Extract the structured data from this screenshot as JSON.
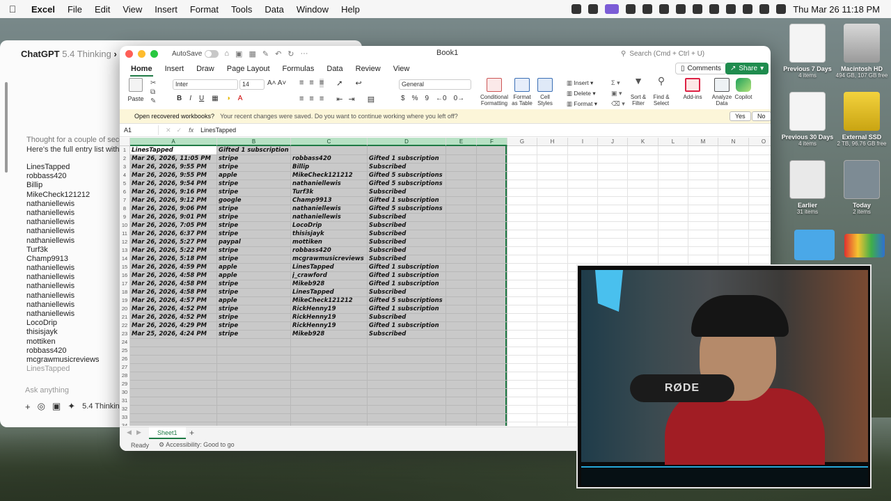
{
  "menubar": {
    "app": "Excel",
    "items": [
      "File",
      "Edit",
      "View",
      "Insert",
      "Format",
      "Tools",
      "Data",
      "Window",
      "Help"
    ],
    "datetime": "Thu Mar 26  11:18 PM"
  },
  "chat": {
    "title": "ChatGPT",
    "model": "5.4 Thinking",
    "thought": "Thought for a couple of seconds",
    "intro": "Here's the full entry list with names",
    "names": [
      "LinesTapped",
      "robbass420",
      "Billip",
      "MikeCheck121212",
      "nathaniellewis",
      "nathaniellewis",
      "nathaniellewis",
      "nathaniellewis",
      "nathaniellewis",
      "Turf3k",
      "Champ9913",
      "nathaniellewis",
      "nathaniellewis",
      "nathaniellewis",
      "nathaniellewis",
      "nathaniellewis",
      "nathaniellewis",
      "LocoDrip",
      "thisisjayk",
      "mottiken",
      "robbass420",
      "mcgrawmusicreviews",
      "LinesTapped"
    ],
    "ask_placeholder": "Ask anything",
    "model_short": "5.4 Thinkin"
  },
  "excel": {
    "autosave": "AutoSave",
    "doc_title": "Book1",
    "search_placeholder": "Search (Cmd + Ctrl + U)",
    "tabs": [
      "Home",
      "Insert",
      "Draw",
      "Page Layout",
      "Formulas",
      "Data",
      "Review",
      "View"
    ],
    "comments": "Comments",
    "share": "Share",
    "ribbon": {
      "paste": "Paste",
      "font": "Inter",
      "size": "14",
      "number_format": "General",
      "conditional": "Conditional Formatting",
      "format_table": "Format as Table",
      "cell_styles": "Cell Styles",
      "insert": "Insert",
      "delete": "Delete",
      "format": "Format",
      "sort_filter": "Sort & Filter",
      "find_select": "Find & Select",
      "addins": "Add-ins",
      "analyze": "Analyze Data",
      "copilot": "Copilot"
    },
    "notice": {
      "title": "Open recovered workbooks?",
      "message": "Your recent changes were saved. Do you want to continue working where you left off?",
      "yes": "Yes",
      "no": "No"
    },
    "namebox": "A1",
    "formula": "LinesTapped",
    "columns": [
      "A",
      "B",
      "C",
      "D",
      "E",
      "F",
      "G",
      "H",
      "I",
      "J",
      "K",
      "L",
      "M",
      "N",
      "O"
    ],
    "rows": [
      [
        "LinesTapped",
        "Gifted 1 subscription",
        "",
        ""
      ],
      [
        "Mar 26, 2026, 11:05 PM",
        "stripe",
        "robbass420",
        "Gifted 1 subscription"
      ],
      [
        "Mar 26, 2026, 9:55 PM",
        "stripe",
        "Billip",
        "Subscribed"
      ],
      [
        "Mar 26, 2026, 9:55 PM",
        "apple",
        "MikeCheck121212",
        "Gifted 5 subscriptions"
      ],
      [
        "Mar 26, 2026, 9:54 PM",
        "stripe",
        "nathaniellewis",
        "Gifted 5 subscriptions"
      ],
      [
        "Mar 26, 2026, 9:16 PM",
        "stripe",
        "Turf3k",
        "Subscribed"
      ],
      [
        "Mar 26, 2026, 9:12 PM",
        "google",
        "Champ9913",
        "Gifted 1 subscription"
      ],
      [
        "Mar 26, 2026, 9:06 PM",
        "stripe",
        "nathaniellewis",
        "Gifted 5 subscriptions"
      ],
      [
        "Mar 26, 2026, 9:01 PM",
        "stripe",
        "nathaniellewis",
        "Subscribed"
      ],
      [
        "Mar 26, 2026, 7:05 PM",
        "stripe",
        "LocoDrip",
        "Subscribed"
      ],
      [
        "Mar 26, 2026, 6:37 PM",
        "stripe",
        "thisisjayk",
        "Subscribed"
      ],
      [
        "Mar 26, 2026, 5:27 PM",
        "paypal",
        "mottiken",
        "Subscribed"
      ],
      [
        "Mar 26, 2026, 5:22 PM",
        "stripe",
        "robbass420",
        "Subscribed"
      ],
      [
        "Mar 26, 2026, 5:18 PM",
        "stripe",
        "mcgrawmusicreviews",
        "Subscribed"
      ],
      [
        "Mar 26, 2026, 4:59 PM",
        "apple",
        "LinesTapped",
        "Gifted 1 subscription"
      ],
      [
        "Mar 26, 2026, 4:58 PM",
        "apple",
        "j_crawford",
        "Gifted 1 subscription"
      ],
      [
        "Mar 26, 2026, 4:58 PM",
        "stripe",
        "Mikeb928",
        "Gifted 1 subscription"
      ],
      [
        "Mar 26, 2026, 4:58 PM",
        "stripe",
        "LinesTapped",
        "Subscribed"
      ],
      [
        "Mar 26, 2026, 4:57 PM",
        "apple",
        "MikeCheck121212",
        "Gifted 5 subscriptions"
      ],
      [
        "Mar 26, 2026, 4:52 PM",
        "stripe",
        "RickHenny19",
        "Gifted 1 subscription"
      ],
      [
        "Mar 26, 2026, 4:52 PM",
        "stripe",
        "RickHenny19",
        "Subscribed"
      ],
      [
        "Mar 26, 2026, 4:29 PM",
        "stripe",
        "RickHenny19",
        "Gifted 1 subscription"
      ],
      [
        "Mar 25, 2026, 4:24 PM",
        "stripe",
        "Mikeb928",
        "Subscribed"
      ]
    ],
    "sheet": "Sheet1",
    "status_ready": "Ready",
    "status_access": "Accessibility: Good to go"
  },
  "desktop": {
    "items": [
      {
        "label": "Previous 7 Days",
        "sub": "4 items"
      },
      {
        "label": "Macintosh HD",
        "sub": "494 GB, 107 GB free"
      },
      {
        "label": "Previous 30 Days",
        "sub": "4 items"
      },
      {
        "label": "External SSD",
        "sub": "2 TB, 96.76 GB free"
      },
      {
        "label": "Earlier",
        "sub": "31 items"
      },
      {
        "label": "Today",
        "sub": "2 items"
      }
    ],
    "mic_brand": "RØDE"
  },
  "colors": {
    "excel_green": "#1f7a45",
    "selection_gray": "#c9c9c9",
    "notice_bg": "#fcf6d9"
  }
}
